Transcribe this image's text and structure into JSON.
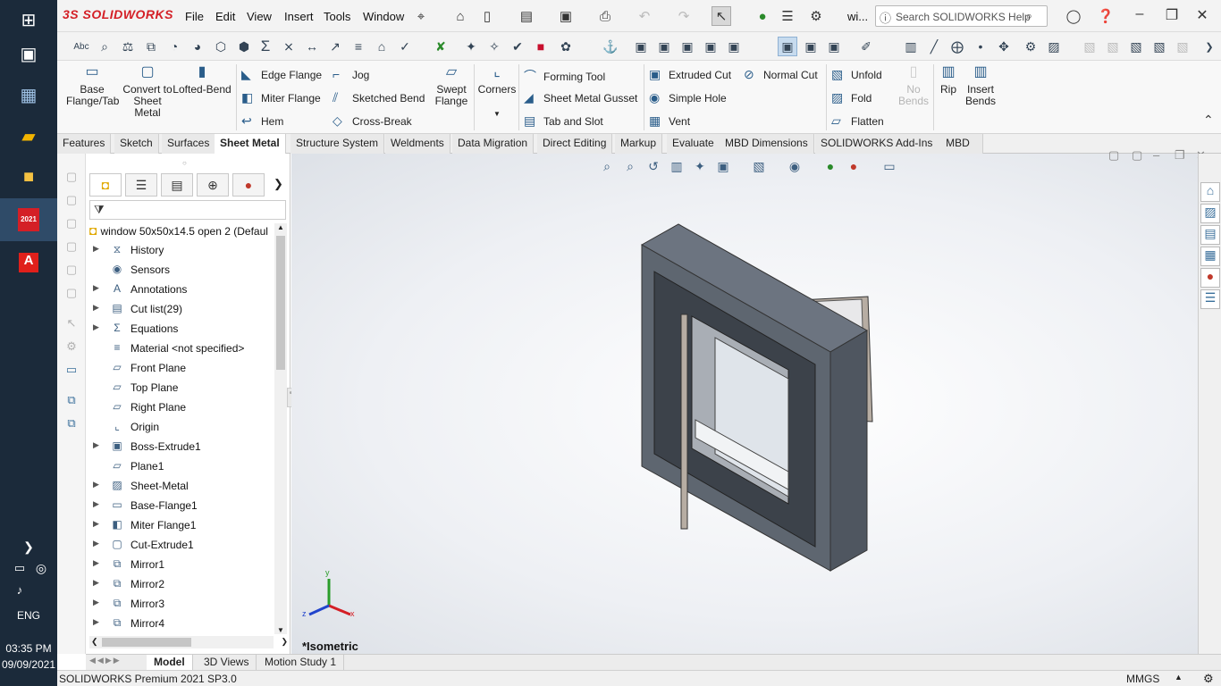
{
  "taskbar": {
    "time": "03:35 PM",
    "date": "09/09/2021",
    "language": "ENG",
    "sw_badge": "2021",
    "icons": [
      "windows-start-icon",
      "task-view-icon",
      "calculator-icon",
      "app-icon",
      "file-explorer-icon",
      "solidworks-icon",
      "acrobat-icon",
      "chevron-right-icon",
      "network-icon",
      "globe-icon",
      "volume-icon"
    ]
  },
  "titlebar": {
    "logo": "3S SOLIDWORKS",
    "menus": [
      "File",
      "Edit",
      "View",
      "Insert",
      "Tools",
      "Window"
    ],
    "doc_short": "wi...",
    "search_placeholder": "Search SOLIDWORKS Help"
  },
  "ribbon": {
    "base_flange": "Base Flange/Tab",
    "convert": "Convert to Sheet Metal",
    "lofted": "Lofted-Bend",
    "edge_flange": "Edge Flange",
    "miter_flange": "Miter Flange",
    "hem": "Hem",
    "jog": "Jog",
    "sketched_bend": "Sketched Bend",
    "cross_break": "Cross-Break",
    "swept_flange": "Swept Flange",
    "corners": "Corners",
    "forming_tool": "Forming Tool",
    "gusset": "Sheet Metal Gusset",
    "tab_slot": "Tab and Slot",
    "extruded_cut": "Extruded Cut",
    "simple_hole": "Simple Hole",
    "vent": "Vent",
    "normal_cut": "Normal Cut",
    "unfold": "Unfold",
    "fold": "Fold",
    "flatten": "Flatten",
    "no_bends": "No Bends",
    "rip": "Rip",
    "insert_bends": "Insert Bends"
  },
  "tabs": [
    "Features",
    "Sketch",
    "Surfaces",
    "Sheet Metal",
    "Structure System",
    "Weldments",
    "Data Migration",
    "Direct Editing",
    "Markup",
    "Evaluate",
    "MBD Dimensions",
    "SOLIDWORKS Add-Ins",
    "MBD"
  ],
  "active_tab": "Sheet Metal",
  "tree": {
    "root": "window 50x50x14.5 open 2  (Defaul",
    "items": [
      {
        "label": "History",
        "expand": true,
        "icon": "history-icon"
      },
      {
        "label": "Sensors",
        "expand": false,
        "icon": "sensors-icon"
      },
      {
        "label": "Annotations",
        "expand": true,
        "icon": "annotations-icon"
      },
      {
        "label": "Cut list(29)",
        "expand": true,
        "icon": "cut-list-icon"
      },
      {
        "label": "Equations",
        "expand": true,
        "icon": "equations-icon"
      },
      {
        "label": "Material <not specified>",
        "expand": false,
        "icon": "material-icon"
      },
      {
        "label": "Front Plane",
        "expand": false,
        "icon": "plane-icon"
      },
      {
        "label": "Top Plane",
        "expand": false,
        "icon": "plane-icon"
      },
      {
        "label": "Right Plane",
        "expand": false,
        "icon": "plane-icon"
      },
      {
        "label": "Origin",
        "expand": false,
        "icon": "origin-icon"
      },
      {
        "label": "Boss-Extrude1",
        "expand": true,
        "icon": "extrude-icon"
      },
      {
        "label": "Plane1",
        "expand": false,
        "icon": "plane-icon"
      },
      {
        "label": "Sheet-Metal",
        "expand": true,
        "icon": "sheet-metal-icon"
      },
      {
        "label": "Base-Flange1",
        "expand": true,
        "icon": "base-flange-icon"
      },
      {
        "label": "Miter Flange1",
        "expand": true,
        "icon": "miter-flange-icon"
      },
      {
        "label": "Cut-Extrude1",
        "expand": true,
        "icon": "cut-extrude-icon"
      },
      {
        "label": "Mirror1",
        "expand": true,
        "icon": "mirror-icon"
      },
      {
        "label": "Mirror2",
        "expand": true,
        "icon": "mirror-icon"
      },
      {
        "label": "Mirror3",
        "expand": true,
        "icon": "mirror-icon"
      },
      {
        "label": "Mirror4",
        "expand": true,
        "icon": "mirror-icon"
      }
    ]
  },
  "viewport": {
    "view_label": "*Isometric",
    "axis_x": "x",
    "axis_y": "y",
    "axis_z": "z"
  },
  "bottom_tabs": [
    "Model",
    "3D Views",
    "Motion Study 1"
  ],
  "active_bottom_tab": "Model",
  "status": {
    "product": "SOLIDWORKS Premium 2021 SP3.0",
    "units": "MMGS"
  }
}
